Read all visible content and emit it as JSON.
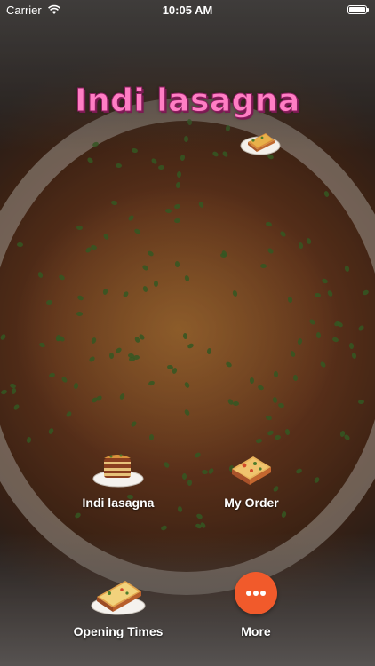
{
  "status_bar": {
    "carrier": "Carrier",
    "time": "10:05 AM"
  },
  "app": {
    "title": "Indi lasagna"
  },
  "menu": [
    {
      "label": "Indi lasagna",
      "icon": "lasagna-plate-icon"
    },
    {
      "label": "My Order",
      "icon": "lasagna-slice-icon"
    },
    {
      "label": "Opening Times",
      "icon": "lasagna-dish-icon"
    },
    {
      "label": "More",
      "icon": "more-dots-icon"
    }
  ],
  "colors": {
    "title": "#ff7ec4",
    "title_outline": "#8a1f5e",
    "more_button": "#f15a2b",
    "label": "#ffffff"
  }
}
